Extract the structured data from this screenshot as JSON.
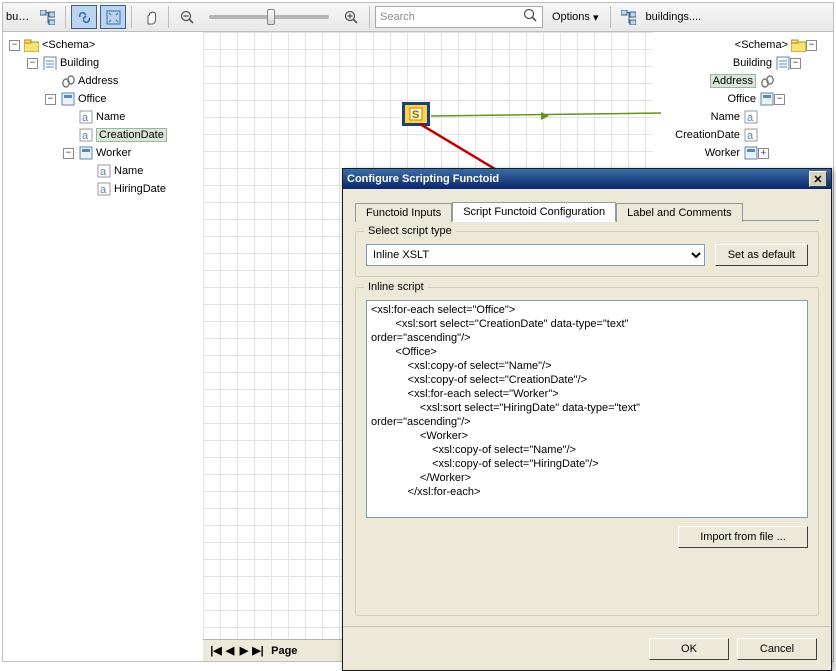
{
  "toolbar": {
    "file_left": "buildings....",
    "file_right": "buildings....",
    "search_placeholder": "Search",
    "options_label": "Options",
    "options_arrow": "▾"
  },
  "left_tree": {
    "root": "<Schema>",
    "n1": "Building",
    "n2": "Address",
    "n3": "Office",
    "n4": "Name",
    "n5": "CreationDate",
    "n6": "Worker",
    "n7": "Name",
    "n8": "HiringDate"
  },
  "right_tree": {
    "root": "<Schema>",
    "n1": "Building",
    "n2": "Address",
    "n3": "Office",
    "n4": "Name",
    "n5": "CreationDate",
    "n6": "Worker"
  },
  "pager": {
    "first": "|◀",
    "prev": "◀",
    "next": "▶",
    "last": "▶|",
    "label": "Page"
  },
  "dialog": {
    "title": "Configure Scripting Functoid",
    "tabs": {
      "t1": "Functoid Inputs",
      "t2": "Script Functoid Configuration",
      "t3": "Label and Comments"
    },
    "group_script_type": "Select script type",
    "script_type_options": [
      "Inline XSLT"
    ],
    "set_default": "Set as default",
    "group_inline": "Inline script",
    "code": "<xsl:for-each select=\"Office\">\n        <xsl:sort select=\"CreationDate\" data-type=\"text\"\norder=\"ascending\"/>\n        <Office>\n            <xsl:copy-of select=\"Name\"/>\n            <xsl:copy-of select=\"CreationDate\"/>\n            <xsl:for-each select=\"Worker\">\n                <xsl:sort select=\"HiringDate\" data-type=\"text\"\norder=\"ascending\"/>\n                <Worker>\n                    <xsl:copy-of select=\"Name\"/>\n                    <xsl:copy-of select=\"HiringDate\"/>\n                </Worker>\n            </xsl:for-each>",
    "import": "Import from file ...",
    "ok": "OK",
    "cancel": "Cancel"
  },
  "glyph": {
    "minus": "−",
    "plus": "+",
    "x": "✕",
    "dropdown": "▾"
  }
}
